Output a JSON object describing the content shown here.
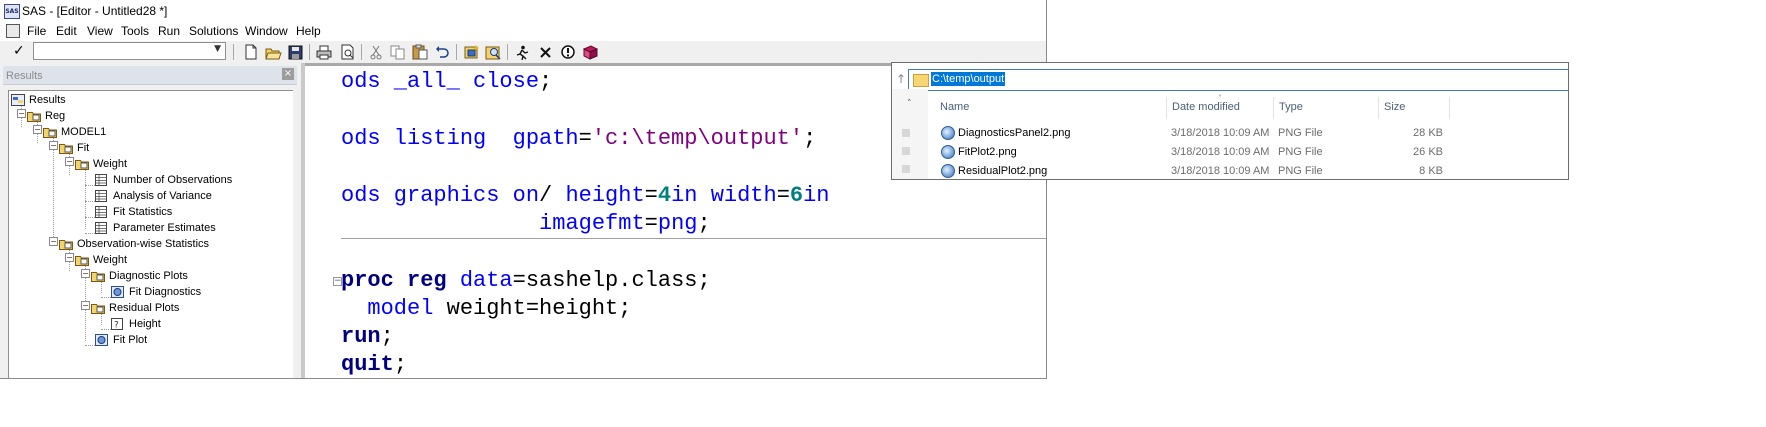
{
  "window": {
    "title": "SAS - [Editor - Untitled28 *]",
    "app_icon_text": "SAS"
  },
  "menu": [
    "File",
    "Edit",
    "View",
    "Tools",
    "Run",
    "Solutions",
    "Window",
    "Help"
  ],
  "toolbar": {
    "command_value": "",
    "buttons": [
      "checkmark-icon",
      "new-icon",
      "open-icon",
      "save-icon",
      "print-icon",
      "print-preview-icon",
      "cut-icon",
      "copy-icon",
      "paste-icon",
      "undo-icon",
      "new-library-icon",
      "find-icon",
      "submit-icon",
      "clear-icon",
      "break-icon",
      "help-icon"
    ]
  },
  "results": {
    "title": "Results",
    "close": "×",
    "tree": {
      "root": "Results",
      "reg": "Reg",
      "model": "MODEL1",
      "fit": "Fit",
      "weight1": "Weight",
      "nobs": "Number of Observations",
      "anova": "Analysis of Variance",
      "fitstats": "Fit Statistics",
      "params": "Parameter Estimates",
      "obswise": "Observation-wise Statistics",
      "weight2": "Weight",
      "diagplots": "Diagnostic Plots",
      "fitdiag": "Fit Diagnostics",
      "residplots": "Residual Plots",
      "height": "Height",
      "fitplot": "Fit Plot"
    }
  },
  "editor": {
    "line1": {
      "kw": "ods _all_ close",
      "end": ";"
    },
    "line2": {
      "kw": "ods listing  gpath",
      "eq": "=",
      "str": "'c:\\temp\\output'",
      "end": ";"
    },
    "line3": {
      "kw": "ods graphics on",
      "slash": "/ ",
      "kw2": "height",
      "eq": "=",
      "num1": "4",
      "unit1": "in ",
      "kw3": "width",
      "eq2": "=",
      "num2": "6",
      "unit2": "in"
    },
    "line4": {
      "indent": "               ",
      "kw": "imagefmt",
      "eq": "=",
      "val": "png",
      "end": ";"
    },
    "line5": {
      "kw": "proc reg",
      "sp": " ",
      "kw2": "data",
      "rest": "=sashelp.class;"
    },
    "line6": {
      "indent": "  ",
      "kw": "model",
      "rest": " weight=height;"
    },
    "line7": {
      "kw": "run",
      "end": ";"
    },
    "line8": {
      "kw": "quit",
      "end": ";"
    },
    "fold_marker": "−"
  },
  "explorer": {
    "back": "↑",
    "address": "C:\\temp\\output",
    "columns": {
      "name": "Name",
      "date": "Date modified",
      "type": "Type",
      "size": "Size"
    },
    "files": [
      {
        "name": "DiagnosticsPanel2.png",
        "date": "3/18/2018 10:09 AM",
        "type": "PNG File",
        "size": "28 KB"
      },
      {
        "name": "FitPlot2.png",
        "date": "3/18/2018 10:09 AM",
        "type": "PNG File",
        "size": "26 KB"
      },
      {
        "name": "ResidualPlot2.png",
        "date": "3/18/2018 10:09 AM",
        "type": "PNG File",
        "size": "8 KB"
      }
    ]
  }
}
